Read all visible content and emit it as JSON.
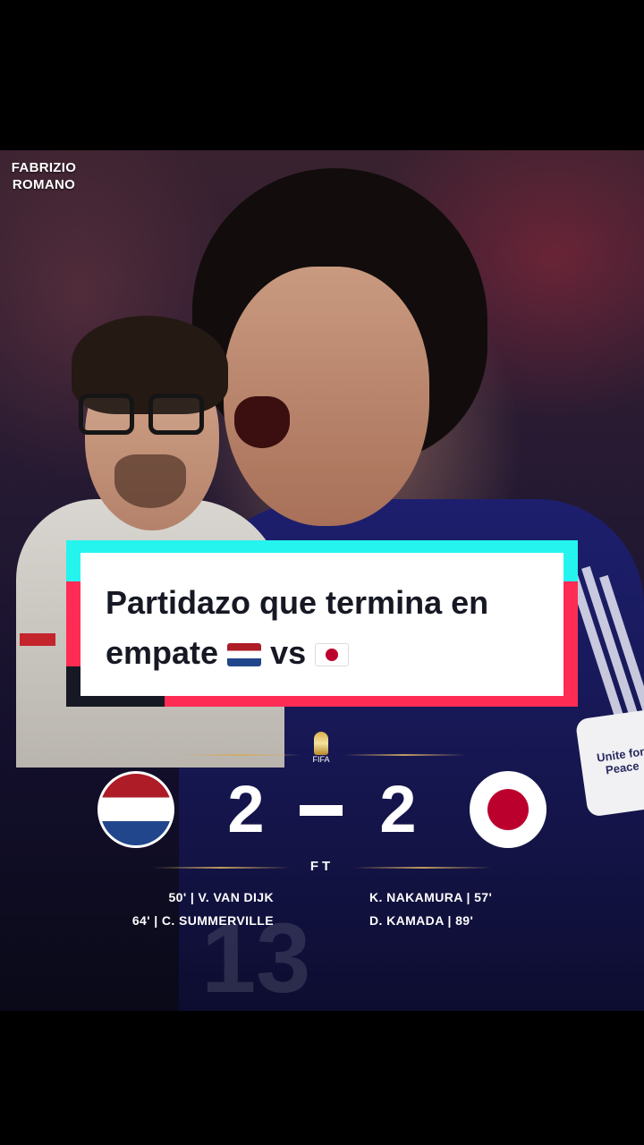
{
  "brand": {
    "line1": "FABRIZIO",
    "line2": "ROMANO"
  },
  "caption": {
    "line1": "Partidazo que termina en",
    "line2_word": "empate",
    "vs": "vs"
  },
  "background": {
    "jersey_team": "JAPAN",
    "jersey_number": "13",
    "patch_text": "Unite for Peace",
    "tournament_logo_text": "FIFA"
  },
  "match": {
    "home_team_flag": "netherlands-flag",
    "away_team_flag": "japan-flag",
    "home_score": "2",
    "away_score": "2",
    "status": "FT",
    "home_scorers": [
      "50'  |  V. VAN DIJK",
      "64'  |  C. SUMMERVILLE"
    ],
    "away_scorers": [
      "K. NAKAMURA  |  57'",
      "D. KAMADA  |  89'"
    ]
  },
  "colors": {
    "cyan": "#25f4ee",
    "red": "#fe2c55",
    "dark": "#161823",
    "nl_red": "#ae1c28",
    "nl_blue": "#21468b",
    "jp_red": "#bc002d"
  }
}
